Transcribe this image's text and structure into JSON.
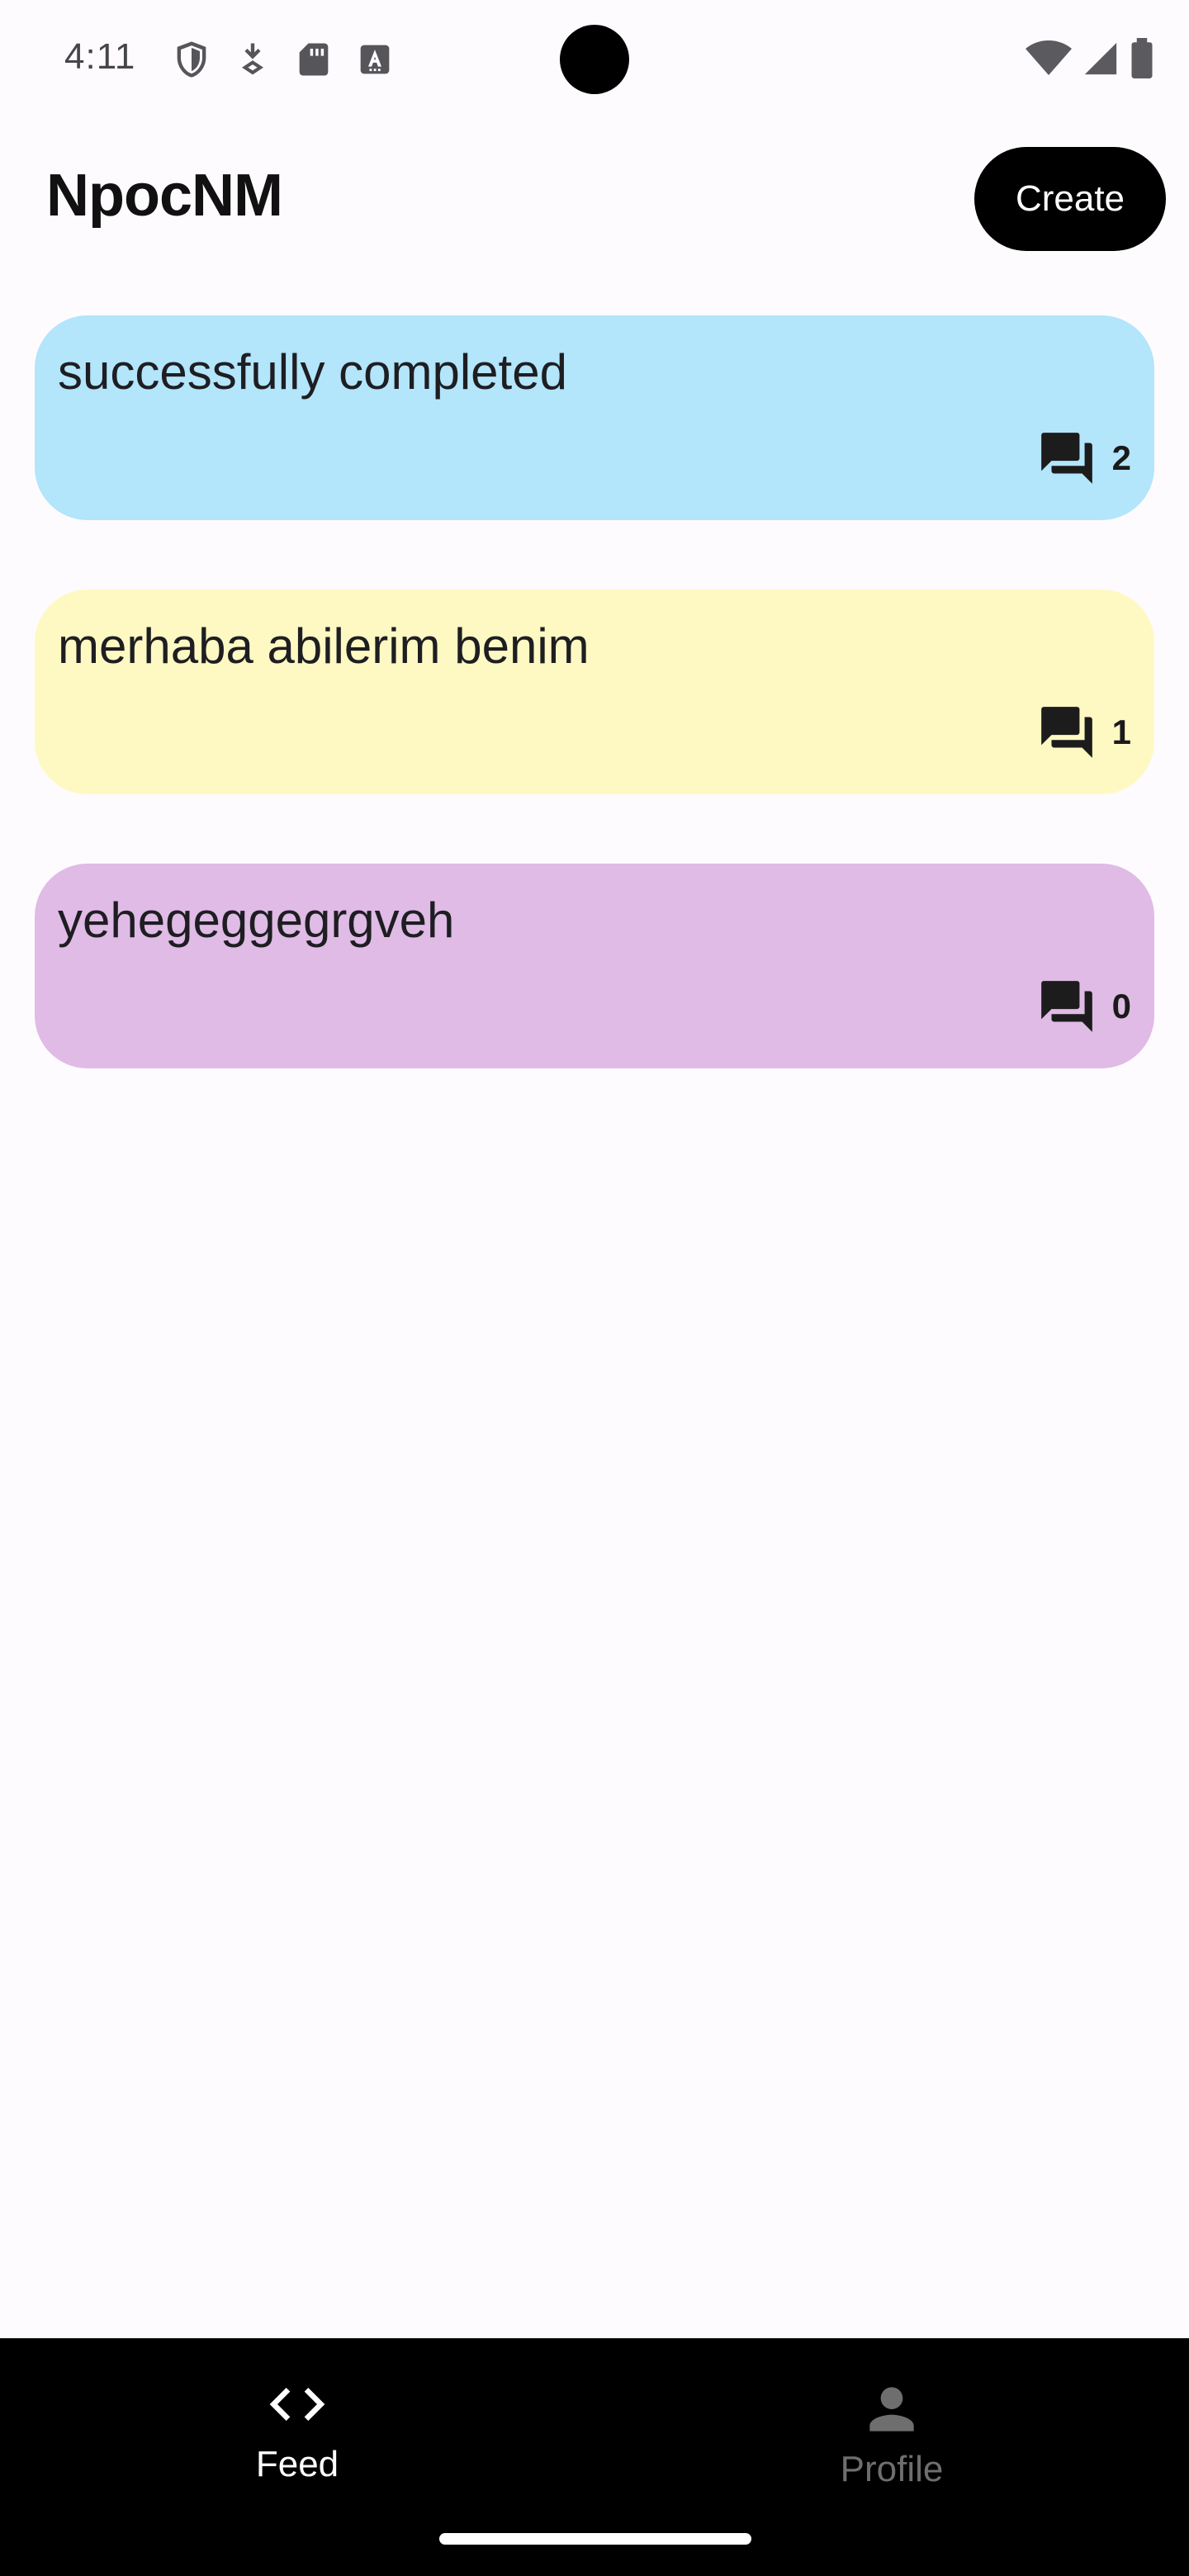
{
  "status_bar": {
    "time": "4:11",
    "left_icons": [
      "shield-icon",
      "download-security-icon",
      "sd-card-icon",
      "font-icon"
    ],
    "right_icons": [
      "wifi-icon",
      "signal-icon",
      "battery-icon"
    ]
  },
  "app_bar": {
    "title": "NpocNM",
    "create_label": "Create"
  },
  "feed": {
    "posts": [
      {
        "text": "successfully completed",
        "comment_count": "2",
        "color": "#b3e5fb"
      },
      {
        "text": "merhaba abilerim benim",
        "comment_count": "1",
        "color": "#fef9c3"
      },
      {
        "text": "yehegeggegrgveh",
        "comment_count": "0",
        "color": "#e0bbe6"
      }
    ],
    "comment_icon": "forum-icon"
  },
  "bottom_nav": {
    "items": [
      {
        "label": "Feed",
        "icon": "code-icon",
        "active": true
      },
      {
        "label": "Profile",
        "icon": "person-icon",
        "active": false
      }
    ]
  },
  "colors": {
    "background": "#fefbfe",
    "nav_background": "#000000",
    "button_background": "#000000",
    "inactive_nav": "#6e6e6e"
  }
}
